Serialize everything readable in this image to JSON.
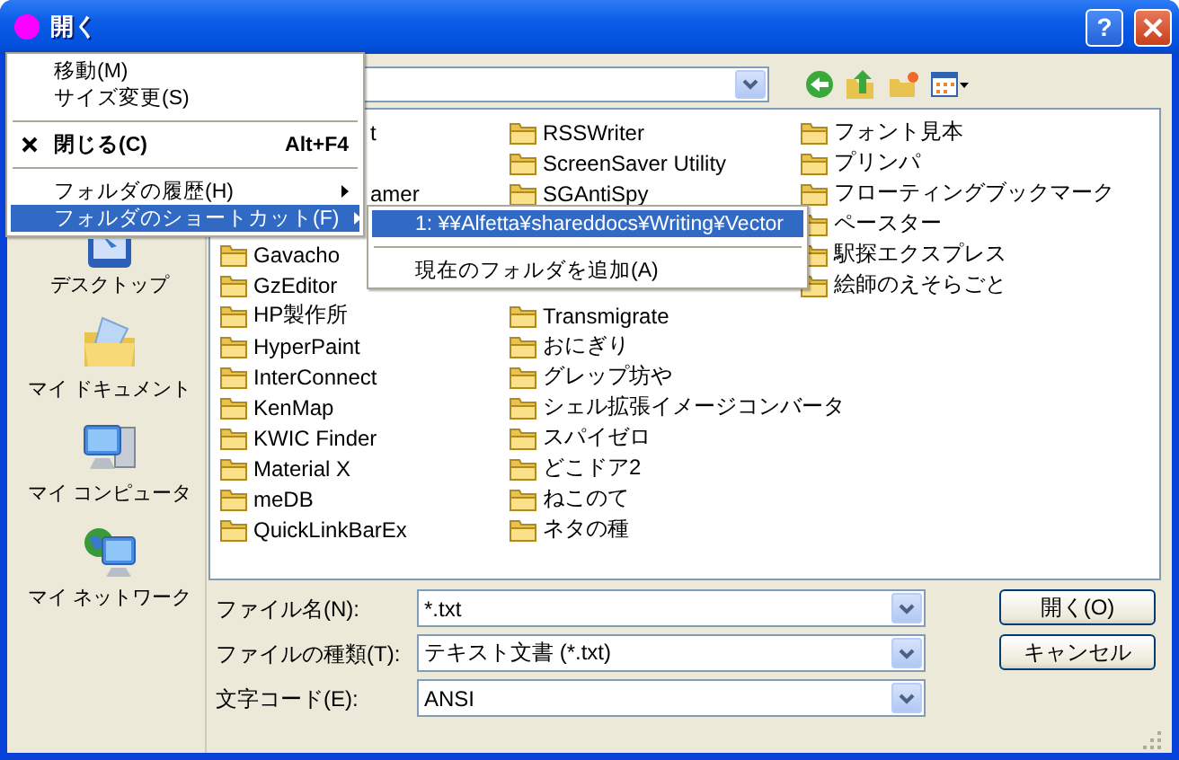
{
  "window": {
    "title": "開く",
    "help_button": "?"
  },
  "places": [
    {
      "label": "デスクトップ",
      "kind": "desktop"
    },
    {
      "label": "マイ ドキュメント",
      "kind": "documents"
    },
    {
      "label": "マイ コンピュータ",
      "kind": "computer"
    },
    {
      "label": "マイ ネットワーク",
      "kind": "network"
    }
  ],
  "file_list": {
    "columns": [
      {
        "items": [
          {
            "kind": "fragment",
            "label": "t"
          },
          {
            "kind": "covered"
          },
          {
            "kind": "fragment",
            "label": "amer"
          },
          {
            "kind": "covered"
          },
          {
            "kind": "folder",
            "label": "Gavacho"
          },
          {
            "kind": "folder",
            "label": "GzEditor"
          },
          {
            "kind": "folder",
            "label": "HP製作所"
          },
          {
            "kind": "folder",
            "label": "HyperPaint"
          },
          {
            "kind": "folder",
            "label": "InterConnect"
          },
          {
            "kind": "folder",
            "label": "KenMap"
          },
          {
            "kind": "folder",
            "label": "KWIC Finder"
          },
          {
            "kind": "folder",
            "label": "Material X"
          },
          {
            "kind": "folder",
            "label": "meDB"
          },
          {
            "kind": "folder",
            "label": "QuickLinkBarEx"
          }
        ]
      },
      {
        "items": [
          {
            "kind": "folder",
            "label": "RSSWriter"
          },
          {
            "kind": "folder",
            "label": "ScreenSaver Utility"
          },
          {
            "kind": "folder",
            "label": "SGAntiSpy"
          },
          {
            "kind": "covered"
          },
          {
            "kind": "covered"
          },
          {
            "kind": "covered"
          },
          {
            "kind": "folder",
            "label": "Transmigrate"
          },
          {
            "kind": "folder",
            "label": "おにぎり"
          },
          {
            "kind": "folder",
            "label": "グレップ坊や"
          },
          {
            "kind": "folder",
            "label": "シェル拡張イメージコンバータ"
          },
          {
            "kind": "folder",
            "label": "スパイゼロ"
          },
          {
            "kind": "folder",
            "label": "どこドア2"
          },
          {
            "kind": "folder",
            "label": "ねこのて"
          },
          {
            "kind": "folder",
            "label": "ネタの種"
          }
        ]
      },
      {
        "items": [
          {
            "kind": "folder",
            "label": "フォント見本"
          },
          {
            "kind": "folder",
            "label": "プリンパ"
          },
          {
            "kind": "folder",
            "label": "フローティングブックマーク"
          },
          {
            "kind": "folder",
            "label": "ペースター"
          },
          {
            "kind": "folder",
            "label": "駅探エクスプレス"
          },
          {
            "kind": "folder",
            "label": "絵師のえそらごと"
          }
        ]
      }
    ]
  },
  "fields": [
    {
      "label": "ファイル名(N):",
      "value": "*.txt"
    },
    {
      "label": "ファイルの種類(T):",
      "value": "テキスト文書 (*.txt)"
    },
    {
      "label": "文字コード(E):",
      "value": "ANSI"
    }
  ],
  "buttons": [
    "開く(O)",
    "キャンセル"
  ],
  "system_menu": [
    {
      "kind": "item",
      "label": "移動(M)",
      "selected": false,
      "submenu": false
    },
    {
      "kind": "item",
      "label": "サイズ変更(S)",
      "selected": false,
      "submenu": false
    },
    {
      "kind": "separator"
    },
    {
      "kind": "default_item",
      "label": "閉じる(C)",
      "shortcut": "Alt+F4",
      "selected": false,
      "submenu": false
    },
    {
      "kind": "separator"
    },
    {
      "kind": "item",
      "label": "フォルダの履歴(H)",
      "selected": false,
      "submenu": true
    },
    {
      "kind": "item",
      "label": "フォルダのショートカット(F)",
      "selected": true,
      "submenu": true
    }
  ],
  "shortcut_submenu": [
    {
      "kind": "item",
      "label": "1: ¥¥Alfetta¥shareddocs¥Writing¥Vector",
      "selected": true,
      "submenu": false
    },
    {
      "kind": "separator"
    },
    {
      "kind": "item",
      "label": "現在のフォルダを追加(A)",
      "selected": false,
      "submenu": false
    }
  ]
}
